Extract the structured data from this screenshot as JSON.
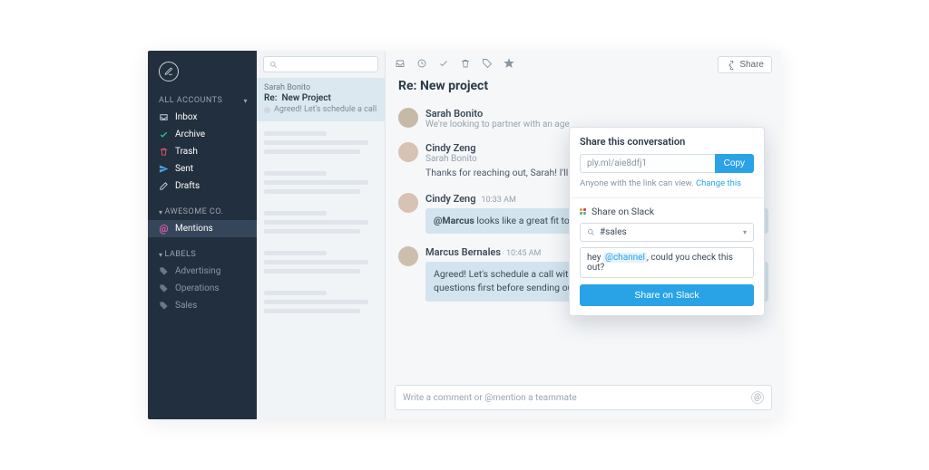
{
  "sidebar": {
    "sections": [
      {
        "label": "ALL ACCOUNTS",
        "items": [
          {
            "name": "inbox",
            "label": "Inbox",
            "icon": "inbox",
            "color": "#cdd5df"
          },
          {
            "name": "archive",
            "label": "Archive",
            "icon": "check",
            "color": "#29c28b"
          },
          {
            "name": "trash",
            "label": "Trash",
            "icon": "trash",
            "color": "#e15a6b"
          },
          {
            "name": "sent",
            "label": "Sent",
            "icon": "send",
            "color": "#4aa3e0"
          },
          {
            "name": "drafts",
            "label": "Drafts",
            "icon": "pencil",
            "color": "#cdd5df"
          }
        ]
      },
      {
        "label": "AWESOME CO.",
        "items": [
          {
            "name": "mentions",
            "label": "Mentions",
            "icon": "at",
            "color": "#e05aa8",
            "selected": true
          }
        ]
      },
      {
        "label": "LABELS",
        "items": [
          {
            "name": "advertising",
            "label": "Advertising",
            "icon": "tag",
            "dim": true
          },
          {
            "name": "operations",
            "label": "Operations",
            "icon": "tag",
            "dim": true
          },
          {
            "name": "sales",
            "label": "Sales",
            "icon": "tag",
            "dim": true
          }
        ]
      }
    ]
  },
  "list": {
    "search_placeholder": "",
    "cards": [
      {
        "from": "Sarah Bonito",
        "subject_prefix": "Re:",
        "subject": "New Project",
        "preview": "Agreed! Let's schedule a call…",
        "selected": true
      }
    ]
  },
  "toolbar": {
    "share_label": "Share",
    "icons": [
      "inbox-open",
      "clock",
      "check",
      "trash",
      "tag",
      "star"
    ]
  },
  "thread": {
    "title": "Re: New project",
    "messages": [
      {
        "avatar": "a1",
        "from": "Sarah Bonito",
        "sub": "We're looking to partner with an age",
        "text": ""
      },
      {
        "avatar": "a2",
        "from": "Cindy Zeng",
        "sub": "Sarah Bonito",
        "text": "Thanks for reaching out, Sarah! I'll talk timeline and pricing as soon as possible."
      },
      {
        "avatar": "a2",
        "from": "Cindy Zeng",
        "time": "10:33 AM",
        "note_before": "@Marcus",
        "note": " looks like a great fit to outline before moving forward."
      },
      {
        "avatar": "a3",
        "from": "Marcus Bernales",
        "time": "10:45 AM",
        "note": "Agreed! Let's schedule a call with Sarah next week, I'd like to ask a few questions first before sending our proposal."
      }
    ],
    "composer_placeholder": "Write a comment or @mention a teammate"
  },
  "share": {
    "title": "Share this conversation",
    "url": "ply.ml/aie8dfj1",
    "copy_label": "Copy",
    "note_text": "Anyone with the link can view. ",
    "note_link": "Change this",
    "slack_header": "Share on Slack",
    "channel": "#sales",
    "message_before": "hey ",
    "message_mention": "@channel",
    "message_after": ", could you check this out?",
    "submit_label": "Share on Slack"
  }
}
